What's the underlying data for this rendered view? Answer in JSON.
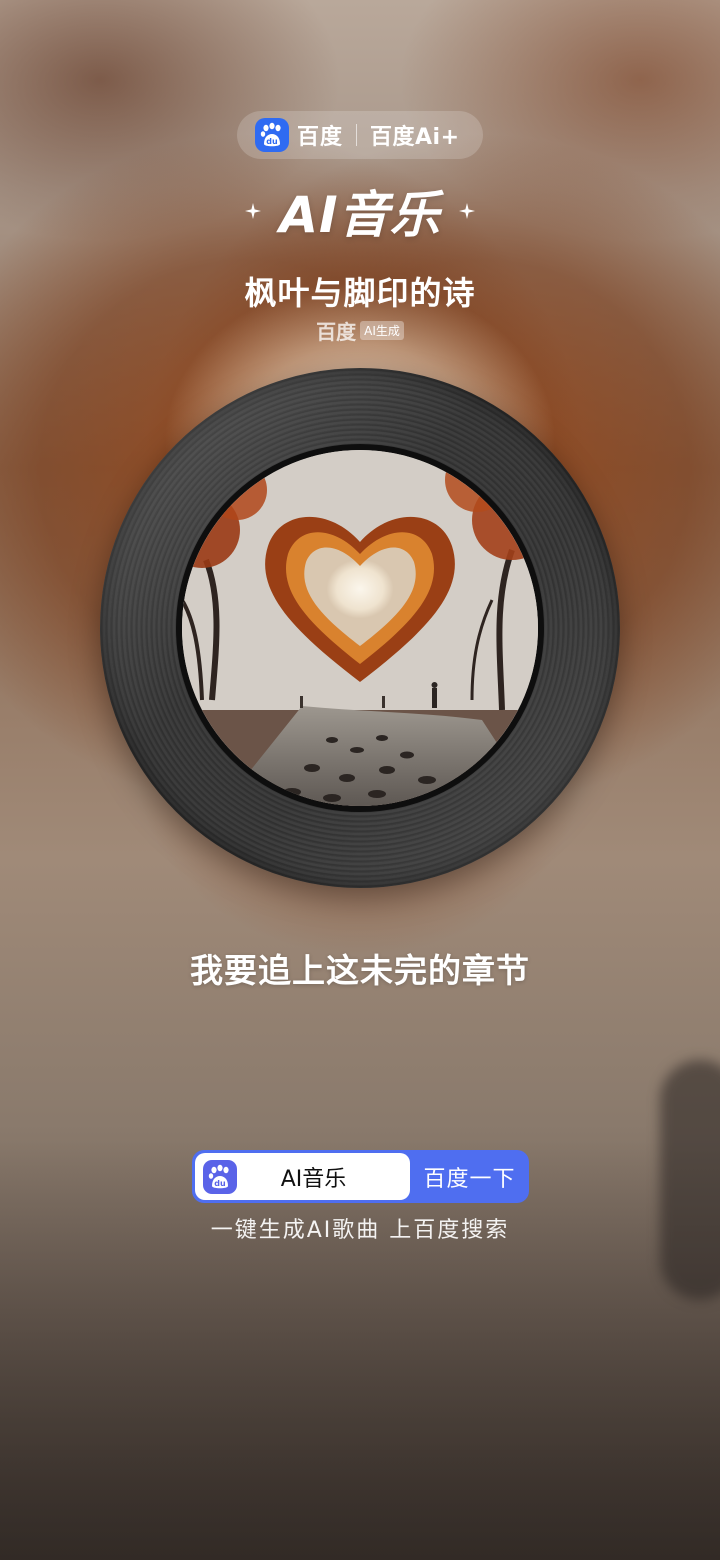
{
  "brand": {
    "baidu_text": "百度",
    "ai_text": "百度Ai+"
  },
  "header": {
    "title": "AI音乐"
  },
  "song": {
    "title": "枫叶与脚印的诗",
    "credit_brand": "百度",
    "credit_tag": "AI生成"
  },
  "cover": {
    "icon": "heart-of-autumn-leaves-artwork"
  },
  "lyric": {
    "current_line": "我要追上这未完的章节"
  },
  "search": {
    "query": "AI音乐",
    "button_label": "百度一下",
    "tagline": "一键生成AI歌曲 上百度搜索"
  },
  "colors": {
    "accent_blue": "#4f6ef0",
    "badge_blue": "#2f6bf2",
    "record_dark": "#333333"
  }
}
